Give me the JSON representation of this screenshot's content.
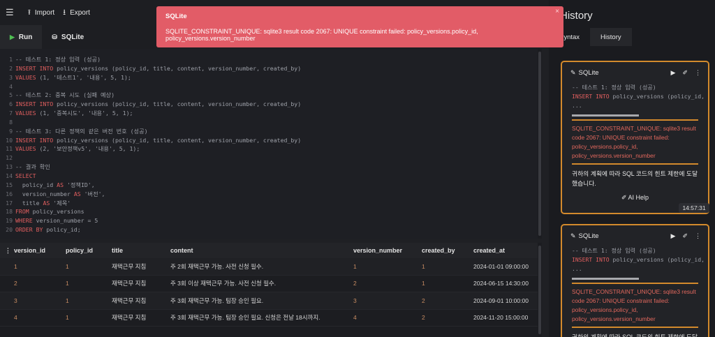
{
  "topbar": {
    "menu_icon": "☰",
    "import_label": "Import",
    "export_label": "Export"
  },
  "editor_tabs": {
    "run_label": "Run",
    "sqlite_label": "SQLite"
  },
  "code_lines": [
    {
      "n": "1",
      "text": "-- 테스트 1: 정상 입력 (성공)"
    },
    {
      "n": "2",
      "text": "INSERT INTO policy_versions (policy_id, title, content, version_number, created_by)"
    },
    {
      "n": "3",
      "text": "VALUES (1, '테스트1', '내용', 5, 1);"
    },
    {
      "n": "4",
      "text": ""
    },
    {
      "n": "5",
      "text": "-- 테스트 2: 중복 시도 (실패 예상)"
    },
    {
      "n": "6",
      "text": "INSERT INTO policy_versions (policy_id, title, content, version_number, created_by)"
    },
    {
      "n": "7",
      "text": "VALUES (1, '중복시도', '내용', 5, 1);"
    },
    {
      "n": "8",
      "text": ""
    },
    {
      "n": "9",
      "text": "-- 테스트 3: 다른 정책의 같은 버전 번호 (성공)"
    },
    {
      "n": "10",
      "text": "INSERT INTO policy_versions (policy_id, title, content, version_number, created_by)"
    },
    {
      "n": "11",
      "text": "VALUES (2, '보안정책v5', '내용', 5, 1);"
    },
    {
      "n": "12",
      "text": ""
    },
    {
      "n": "13",
      "text": "-- 결과 확인"
    },
    {
      "n": "14",
      "text": "SELECT"
    },
    {
      "n": "15",
      "text": "  policy_id AS '정책ID',"
    },
    {
      "n": "16",
      "text": "  version_number AS '버전',"
    },
    {
      "n": "17",
      "text": "  title AS '제목'"
    },
    {
      "n": "18",
      "text": "FROM policy_versions"
    },
    {
      "n": "19",
      "text": "WHERE version_number = 5"
    },
    {
      "n": "20",
      "text": "ORDER BY policy_id;"
    }
  ],
  "results": {
    "menu_icon": "⋮",
    "columns": [
      "version_id",
      "policy_id",
      "title",
      "content",
      "version_number",
      "created_by",
      "created_at"
    ],
    "rows": [
      [
        "1",
        "1",
        "재택근무 지침",
        "주 2회 재택근무 가능. 사전 신청 필수.",
        "1",
        "1",
        "2024-01-01 09:00:00"
      ],
      [
        "2",
        "1",
        "재택근무 지침",
        "주 3회 이상 재택근무 가능. 사전 신청 필수.",
        "2",
        "1",
        "2024-06-15 14:30:00"
      ],
      [
        "3",
        "1",
        "재택근무 지침",
        "주 3회 재택근무 가능. 팀장 승인 필요.",
        "3",
        "2",
        "2024-09-01 10:00:00"
      ],
      [
        "4",
        "1",
        "재택근무 지침",
        "주 3회 재택근무 가능. 팀장 승인 필요. 신청은 전날 18시까지.",
        "4",
        "2",
        "2024-11-20 15:00:00"
      ]
    ]
  },
  "panel": {
    "title": "History",
    "tab_syntax": "Syntax",
    "tab_history": "History"
  },
  "history": [
    {
      "engine": "SQLite",
      "code_lines": [
        "-- 테스트 1: 정상 입력 (성공)",
        "INSERT INTO policy_versions (policy_id,",
        "..."
      ],
      "error": "SQLITE_CONSTRAINT_UNIQUE: sqlite3 result code 2067: UNIQUE constraint failed: policy_versions.policy_id, policy_versions.version_number",
      "message": "귀하의 계획에 따라 SQL 코드의 힌트 제한에 도달했습니다.",
      "ai_help": "AI Help",
      "time": "14:57:31"
    },
    {
      "engine": "SQLite",
      "code_lines": [
        "-- 테스트 1: 정상 입력 (성공)",
        "INSERT INTO policy_versions (policy_id,",
        "..."
      ],
      "error": "SQLITE_CONSTRAINT_UNIQUE: sqlite3 result code 2067: UNIQUE constraint failed: policy_versions.policy_id, policy_versions.version_number",
      "message": "귀하의 계획에 따라 SQL 코드의 힌트 제한에 도달했습니다."
    }
  ],
  "toast": {
    "title": "SQLite",
    "message": "SQLITE_CONSTRAINT_UNIQUE: sqlite3 result code 2067: UNIQUE constraint failed: policy_versions.policy_id, policy_versions.version_number",
    "close": "×"
  }
}
